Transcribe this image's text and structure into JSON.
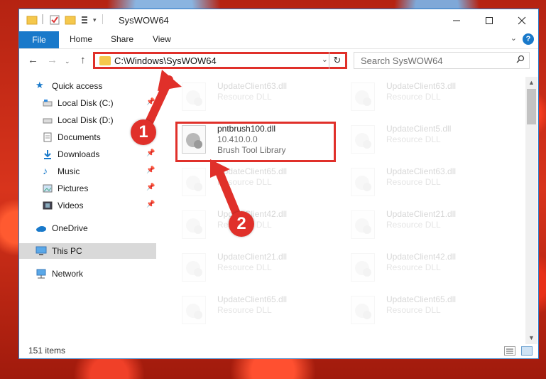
{
  "window": {
    "title": "SysWOW64"
  },
  "ribbon": {
    "tabs": [
      "File",
      "Home",
      "Share",
      "View"
    ],
    "help_label": "?"
  },
  "address": {
    "path": "C:\\Windows\\SysWOW64",
    "search_placeholder": "Search SysWOW64"
  },
  "sidebar": {
    "items": [
      {
        "label": "Quick access",
        "icon": "star-icon"
      },
      {
        "label": "Local Disk (C:)",
        "icon": "drive-icon"
      },
      {
        "label": "Local Disk (D:)",
        "icon": "drive-icon"
      },
      {
        "label": "Documents",
        "icon": "documents-icon"
      },
      {
        "label": "Downloads",
        "icon": "download-icon"
      },
      {
        "label": "Music",
        "icon": "music-icon"
      },
      {
        "label": "Pictures",
        "icon": "pictures-icon"
      },
      {
        "label": "Videos",
        "icon": "videos-icon"
      },
      {
        "label": "OneDrive",
        "icon": "cloud-icon"
      },
      {
        "label": "This PC",
        "icon": "computer-icon"
      },
      {
        "label": "Network",
        "icon": "network-icon"
      }
    ]
  },
  "files": {
    "left": [
      {
        "name": "UpdateClient63.dll",
        "type": "Resource DLL"
      },
      {
        "name": "pntbrush100.dll",
        "version": "10.410.0.0",
        "desc": "Brush Tool Library"
      },
      {
        "name": "UpdateClient65.dll",
        "type": "Resource DLL"
      },
      {
        "name": "UpdateClient42.dll",
        "type": "Resource DLL"
      },
      {
        "name": "UpdateClient21.dll",
        "type": "Resource DLL"
      },
      {
        "name": "UpdateClient65.dll",
        "type": "Resource DLL"
      }
    ],
    "right": [
      {
        "name": "UpdateClient63.dll",
        "type": "Resource DLL"
      },
      {
        "name": "UpdateClient5.dll",
        "type": "Resource DLL"
      },
      {
        "name": "UpdateClient63.dll",
        "type": "Resource DLL"
      },
      {
        "name": "UpdateClient21.dll",
        "type": "Resource DLL"
      },
      {
        "name": "UpdateClient42.dll",
        "type": "Resource DLL"
      },
      {
        "name": "UpdateClient65.dll",
        "type": "Resource DLL"
      }
    ]
  },
  "status": {
    "item_count": "151 items"
  },
  "annotations": {
    "step1": "1",
    "step2": "2",
    "color": "#e0302a"
  }
}
